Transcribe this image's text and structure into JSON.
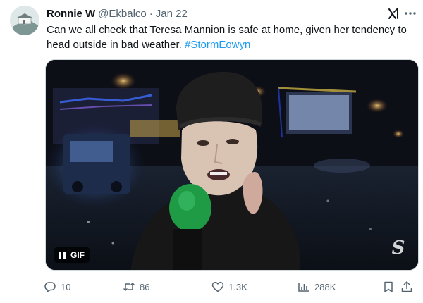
{
  "tweet": {
    "author_name": "Ronnie W",
    "author_handle": "@Ekbalco",
    "separator": "·",
    "date": "Jan 22",
    "text_before_hashtag": "Can we all check that Teresa Mannion is safe at home, given her tendency to head outside in bad weather. ",
    "hashtag": "#StormEowyn"
  },
  "media": {
    "badge_label": "GIF",
    "watermark": "S"
  },
  "actions": {
    "replies": "10",
    "retweets": "86",
    "likes": "1.3K",
    "views": "288K"
  },
  "colors": {
    "text_primary": "#0f1419",
    "text_secondary": "#536471",
    "accent": "#1d9bf0",
    "border": "#cfd9de"
  },
  "icons": {
    "header": [
      "grok-icon",
      "more-icon"
    ],
    "actions": [
      "reply-icon",
      "retweet-icon",
      "like-icon",
      "views-icon",
      "bookmark-icon",
      "share-icon"
    ]
  }
}
